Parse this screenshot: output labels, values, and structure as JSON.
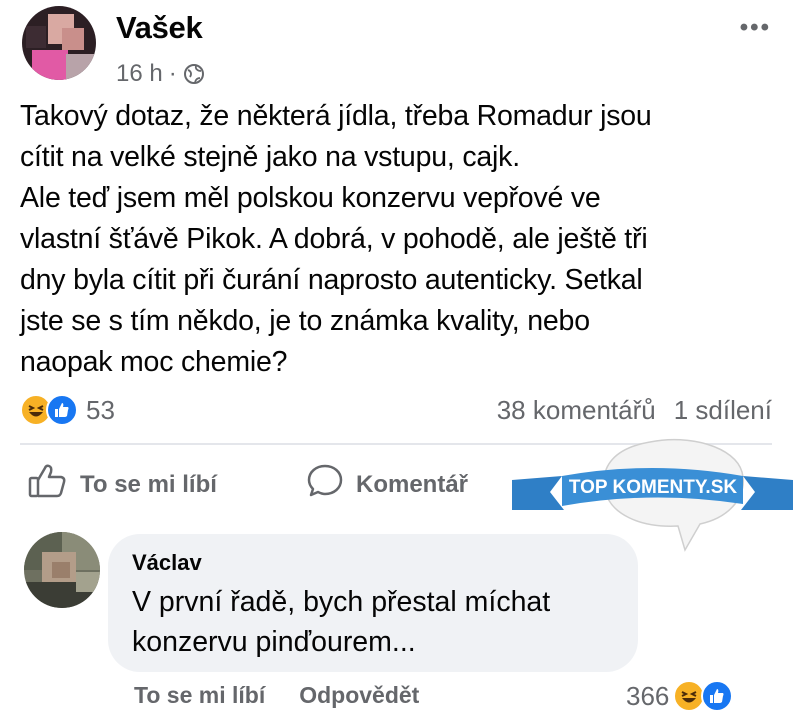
{
  "post": {
    "author": "Vašek",
    "time": "16 h",
    "separator": "·",
    "privacy_icon": "globe-icon",
    "more_icon": "more-options-icon",
    "more_label": "•••",
    "text": "Takový dotaz, že některá jídla, třeba Romadur jsou\ncítit na velké stejně jako na vstupu, cajk.\nAle teď jsem měl polskou konzervu vepřové ve\nvlastní šťávě Pikok. A dobrá, v pohodě, ale ještě tři\ndny byla cítit při čurání naprosto autenticky. Setkal\njste se s tím někdo, je to známka kvality, nebo\nnaopak moc chemie?"
  },
  "stats": {
    "reactions": [
      "haha-icon",
      "like-icon"
    ],
    "reaction_count": "53",
    "comments": "38 komentářů",
    "shares": "1 sdílení"
  },
  "actions": {
    "like_label": "To se mi líbí",
    "comment_label": "Komentář"
  },
  "watermark": {
    "text": "TOP KOMENTY.SK"
  },
  "comment": {
    "author": "Václav",
    "text": "V první řadě, bych přestal míchat\nkonzervu pinďourem...",
    "like_label": "To se mi líbí",
    "reply_label": "Odpovědět",
    "reaction_count": "366",
    "reactions": [
      "haha-icon",
      "like-icon"
    ]
  },
  "colors": {
    "text": "#050505",
    "secondary": "#65676b",
    "like_blue": "#1877f2",
    "haha_yellow": "#f7b125",
    "bubble": "#f0f2f5",
    "ribbon": "#3a8fd6"
  }
}
